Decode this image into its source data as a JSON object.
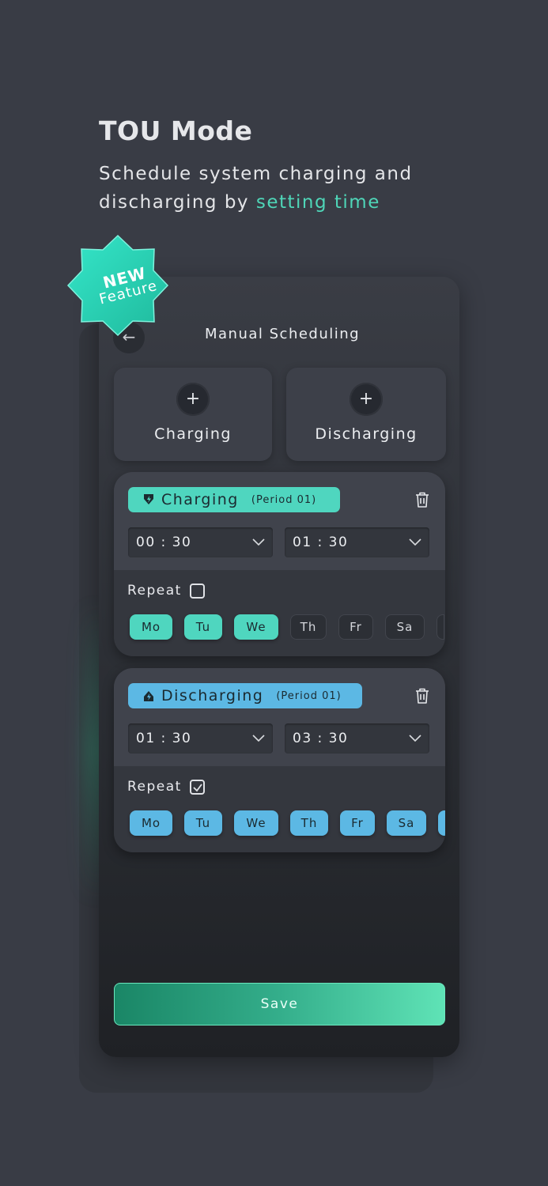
{
  "hero": {
    "title": "TOU Mode",
    "subtitle_prefix": "Schedule system charging and discharging by",
    "subtitle_accent": "setting time"
  },
  "badge": {
    "line1": "NEW",
    "line2": "Feature"
  },
  "screen": {
    "title": "Manual Scheduling",
    "back_icon": "arrow-left-icon"
  },
  "add_buttons": [
    {
      "label": "Charging",
      "icon": "plus-icon"
    },
    {
      "label": "Discharging",
      "icon": "plus-icon"
    }
  ],
  "periods": [
    {
      "type": "Charging",
      "period": "(Period 01)",
      "start": "00 : 30",
      "end": "01 : 30",
      "repeat_label": "Repeat",
      "repeat_checked": false,
      "days": [
        {
          "label": "Mo",
          "active": true
        },
        {
          "label": "Tu",
          "active": true
        },
        {
          "label": "We",
          "active": true
        },
        {
          "label": "Th",
          "active": false
        },
        {
          "label": "Fr",
          "active": false
        },
        {
          "label": "Sa",
          "active": false
        }
      ]
    },
    {
      "type": "Discharging",
      "period": "(Period 01)",
      "start": "01 : 30",
      "end": "03 : 30",
      "repeat_label": "Repeat",
      "repeat_checked": true,
      "days": [
        {
          "label": "Mo",
          "active": true
        },
        {
          "label": "Tu",
          "active": true
        },
        {
          "label": "We",
          "active": true
        },
        {
          "label": "Th",
          "active": true
        },
        {
          "label": "Fr",
          "active": true
        },
        {
          "label": "Sa",
          "active": true
        }
      ]
    }
  ],
  "save_label": "Save",
  "colors": {
    "accent_green": "#4fd6bf",
    "accent_blue": "#5cb8e4",
    "background": "#393c45"
  }
}
